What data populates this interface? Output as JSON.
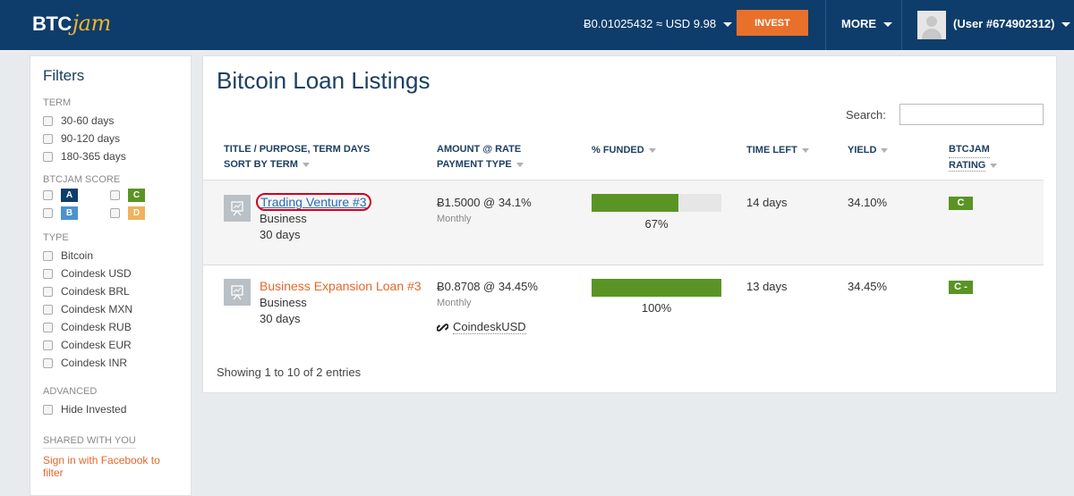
{
  "header": {
    "logo_btc": "BTC",
    "logo_jam": "jam",
    "balance": "Ƀ0.01025432 ≈ USD 9.98",
    "invest_label": "INVEST",
    "more_label": "MORE",
    "user_label": "(User #674902312)"
  },
  "sidebar": {
    "title": "Filters",
    "term_label": "TERM",
    "term_options": [
      "30-60 days",
      "90-120 days",
      "180-365 days"
    ],
    "score_label": "BTCJAM SCORE",
    "grades": [
      {
        "letter": "A",
        "color": "#0e3d6b"
      },
      {
        "letter": "C",
        "color": "#5a9424"
      },
      {
        "letter": "B",
        "color": "#4b93cf"
      },
      {
        "letter": "D",
        "color": "#f0b25c"
      }
    ],
    "type_label": "TYPE",
    "type_options": [
      "Bitcoin",
      "Coindesk USD",
      "Coindesk BRL",
      "Coindesk MXN",
      "Coindesk RUB",
      "Coindesk EUR",
      "Coindesk INR"
    ],
    "advanced_label": "ADVANCED",
    "advanced_option": "Hide Invested",
    "shared_label": "SHARED WITH YOU",
    "facebook_link": "Sign in with Facebook to filter"
  },
  "main": {
    "title": "Bitcoin Loan Listings",
    "search_label": "Search:",
    "columns": {
      "title_line1": "TITLE / PURPOSE, TERM DAYS",
      "title_line2": "SORT BY TERM",
      "amount_line1": "AMOUNT @ RATE",
      "amount_line2": "PAYMENT TYPE",
      "funded": "% FUNDED",
      "time_left": "TIME LEFT",
      "yield": "YIELD",
      "rating_line1": "BTCJAM",
      "rating_line2": "RATING"
    },
    "rows": [
      {
        "title": "Trading Venture #3",
        "purpose": "Business",
        "term": "30 days",
        "amount": "Ƀ1.5000 @ 34.1%",
        "payment_type": "Monthly",
        "funded_fraction": 0.67,
        "funded_label": "67%",
        "time_left": "14 days",
        "yield": "34.10%",
        "rating": "C"
      },
      {
        "title": "Business Expansion Loan #3",
        "purpose": "Business",
        "term": "30 days",
        "amount": "Ƀ0.8708 @ 34.45%",
        "payment_type": "Monthly",
        "currency": "CoindeskUSD",
        "funded_fraction": 1.0,
        "funded_label": "100%",
        "time_left": "13 days",
        "yield": "34.45%",
        "rating": "C -"
      }
    ],
    "showing": "Showing 1 to 10 of 2 entries"
  }
}
